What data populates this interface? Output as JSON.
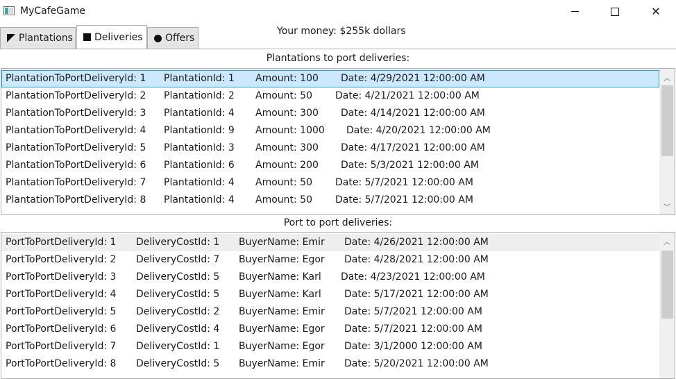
{
  "window": {
    "title": "MyCafeGame"
  },
  "tabs": [
    {
      "label": "Plantations",
      "icon": "triangle-icon"
    },
    {
      "label": "Deliveries",
      "icon": "square-icon"
    },
    {
      "label": "Offers",
      "icon": "circle-icon"
    }
  ],
  "selected_tab": "Deliveries",
  "money": {
    "text": "Your money: $255k dollars"
  },
  "plantation_section": {
    "title": "Plantations to port deliveries:",
    "rows": [
      {
        "id": "PlantationToPortDeliveryId: 1",
        "plantation": "PlantationId: 1",
        "amount": "Amount: 100",
        "date": "Date: 4/29/2021 12:00:00 AM"
      },
      {
        "id": "PlantationToPortDeliveryId: 2",
        "plantation": "PlantationId: 2",
        "amount": "Amount: 50",
        "date": "Date: 4/21/2021 12:00:00 AM"
      },
      {
        "id": "PlantationToPortDeliveryId: 3",
        "plantation": "PlantationId: 4",
        "amount": "Amount: 300",
        "date": "Date: 4/14/2021 12:00:00 AM"
      },
      {
        "id": "PlantationToPortDeliveryId: 4",
        "plantation": "PlantationId: 9",
        "amount": "Amount: 1000",
        "date": "Date: 4/20/2021 12:00:00 AM"
      },
      {
        "id": "PlantationToPortDeliveryId: 5",
        "plantation": "PlantationId: 3",
        "amount": "Amount: 300",
        "date": "Date: 4/17/2021 12:00:00 AM"
      },
      {
        "id": "PlantationToPortDeliveryId: 6",
        "plantation": "PlantationId: 6",
        "amount": "Amount: 200",
        "date": "Date: 5/3/2021 12:00:00 AM"
      },
      {
        "id": "PlantationToPortDeliveryId: 7",
        "plantation": "PlantationId: 4",
        "amount": "Amount: 50",
        "date": "Date: 5/7/2021 12:00:00 AM"
      },
      {
        "id": "PlantationToPortDeliveryId: 8",
        "plantation": "PlantationId: 4",
        "amount": "Amount: 50",
        "date": "Date: 5/7/2021 12:00:00 AM"
      }
    ]
  },
  "port_section": {
    "title": "Port to port deliveries:",
    "rows": [
      {
        "id": "PortToPortDeliveryId: 1",
        "cost": "DeliveryCostId: 1",
        "buyer": "BuyerName: Emir",
        "date": "Date: 4/26/2021 12:00:00 AM"
      },
      {
        "id": "PortToPortDeliveryId: 2",
        "cost": "DeliveryCostId: 7",
        "buyer": "BuyerName: Egor",
        "date": "Date: 4/28/2021 12:00:00 AM"
      },
      {
        "id": "PortToPortDeliveryId: 3",
        "cost": "DeliveryCostId: 5",
        "buyer": "BuyerName: Karl",
        "date": "Date: 4/23/2021 12:00:00 AM"
      },
      {
        "id": "PortToPortDeliveryId: 4",
        "cost": "DeliveryCostId: 5",
        "buyer": "BuyerName: Karl",
        "date": "Date: 5/17/2021 12:00:00 AM"
      },
      {
        "id": "PortToPortDeliveryId: 5",
        "cost": "DeliveryCostId: 2",
        "buyer": "BuyerName: Emir",
        "date": "Date: 5/7/2021 12:00:00 AM"
      },
      {
        "id": "PortToPortDeliveryId: 6",
        "cost": "DeliveryCostId: 4",
        "buyer": "BuyerName: Egor",
        "date": "Date: 5/7/2021 12:00:00 AM"
      },
      {
        "id": "PortToPortDeliveryId: 7",
        "cost": "DeliveryCostId: 1",
        "buyer": "BuyerName: Egor",
        "date": "Date: 3/1/2000 12:00:00 AM"
      },
      {
        "id": "PortToPortDeliveryId: 8",
        "cost": "DeliveryCostId: 5",
        "buyer": "BuyerName: Emir",
        "date": "Date: 5/20/2021 12:00:00 AM"
      }
    ]
  },
  "colors": {
    "selection_bg": "#cce8ff",
    "selection_border": "#26a0da",
    "hover_bg": "#eeeeee"
  }
}
